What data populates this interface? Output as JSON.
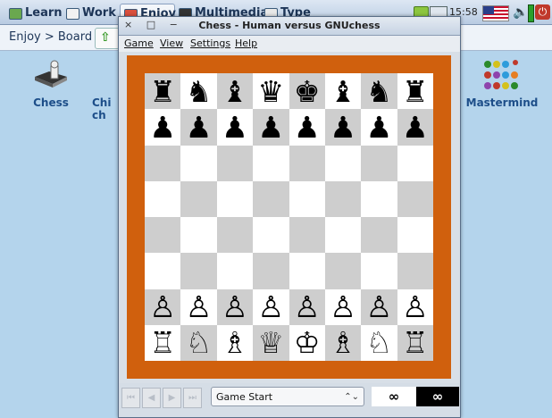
{
  "topbar": {
    "tabs": [
      {
        "label": "Learn",
        "icon": "learn-icon"
      },
      {
        "label": "Work",
        "icon": "work-icon"
      },
      {
        "label": "Enjoy",
        "icon": "enjoy-icon",
        "active": true
      },
      {
        "label": "Multimedia",
        "icon": "multimedia-icon"
      },
      {
        "label": "Type",
        "icon": "type-icon"
      }
    ],
    "clock": "15:58",
    "volume_glyph": "🔈",
    "power_glyph": "⏻"
  },
  "breadcrumb": {
    "text": "Enjoy > Board"
  },
  "launchers": [
    {
      "label": "Chess"
    },
    {
      "label": "Chi ch"
    },
    {
      "label": "Mastermind"
    }
  ],
  "window": {
    "title": "Chess - Human versus GNUchess",
    "wm_buttons": "× □ −",
    "menu": [
      "Game",
      "View",
      "Settings",
      "Help"
    ]
  },
  "board": {
    "ranks": [
      [
        "♜",
        "♞",
        "♝",
        "♛",
        "♚",
        "♝",
        "♞",
        "♜"
      ],
      [
        "♟",
        "♟",
        "♟",
        "♟",
        "♟",
        "♟",
        "♟",
        "♟"
      ],
      [
        "",
        "",
        "",
        "",
        "",
        "",
        "",
        ""
      ],
      [
        "",
        "",
        "",
        "",
        "",
        "",
        "",
        ""
      ],
      [
        "",
        "",
        "",
        "",
        "",
        "",
        "",
        ""
      ],
      [
        "",
        "",
        "",
        "",
        "",
        "",
        "",
        ""
      ],
      [
        "♙",
        "♙",
        "♙",
        "♙",
        "♙",
        "♙",
        "♙",
        "♙"
      ],
      [
        "♖",
        "♘",
        "♗",
        "♕",
        "♔",
        "♗",
        "♘",
        "♖"
      ]
    ],
    "frame_color": "#d0600d",
    "dark_square": "#cecece",
    "light_square": "#ffffff"
  },
  "controls": {
    "nav": [
      "⏮",
      "◀",
      "▶",
      "⏭"
    ],
    "move_select": "Game Start",
    "select_arrow": "⌃⌄",
    "white_time": "∞",
    "black_time": "∞"
  }
}
